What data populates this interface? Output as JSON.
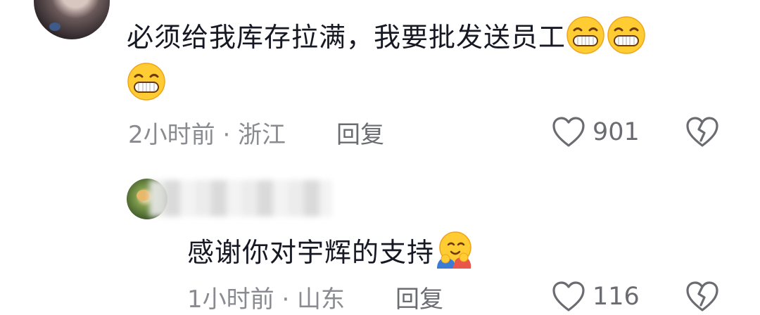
{
  "comment": {
    "text": "必须给我库存拉满，我要批发送员工",
    "emojis": [
      "grinning-face-icon",
      "grinning-face-icon",
      "grinning-face-icon"
    ],
    "time_location": "2小时前 · 浙江",
    "reply_label": "回复",
    "like_count": "901"
  },
  "reply": {
    "text": "感谢你对宇辉的支持",
    "emoji": "hugging-face-icon",
    "time_location": "1小时前 · 山东",
    "reply_label": "回复",
    "like_count": "116"
  },
  "colors": {
    "text": "#161823",
    "meta": "#8a8b91",
    "emoji_yellow": "#ffcc33"
  }
}
